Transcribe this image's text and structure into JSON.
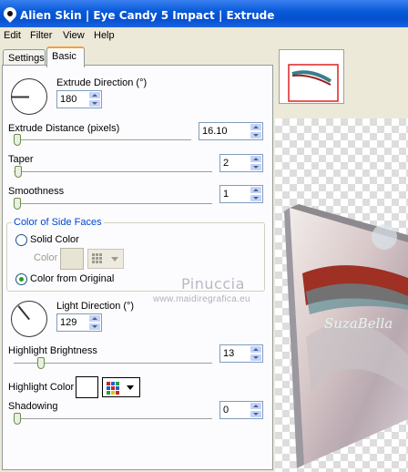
{
  "window": {
    "title": "Alien Skin | Eye Candy 5 Impact | Extrude"
  },
  "menu": [
    "Edit",
    "Filter",
    "View",
    "Help"
  ],
  "tabs": [
    "Settings",
    "Basic"
  ],
  "controls": {
    "extrude_direction_label": "Extrude Direction (°)",
    "extrude_direction_value": "180",
    "extrude_distance_label": "Extrude Distance (pixels)",
    "extrude_distance_value": "16.10",
    "taper_label": "Taper",
    "taper_value": "2",
    "smoothness_label": "Smoothness",
    "smoothness_value": "1",
    "side_faces_group": "Color of Side Faces",
    "solid_color_label": "Solid Color",
    "color_label": "Color",
    "color_from_original_label": "Color from Original",
    "light_direction_label": "Light Direction (°)",
    "light_direction_value": "129",
    "highlight_brightness_label": "Highlight Brightness",
    "highlight_brightness_value": "13",
    "highlight_color_label": "Highlight Color",
    "shadowing_label": "Shadowing",
    "shadowing_value": "0"
  },
  "watermark": {
    "line1": "Pinuccia",
    "line2": "www.maidiregrafica.eu",
    "preview_text": "SuzaBella"
  },
  "colors": {
    "highlight_color": "#ffffff",
    "solid_color": "#e8e4d4",
    "accent": "#0a5bd9"
  }
}
